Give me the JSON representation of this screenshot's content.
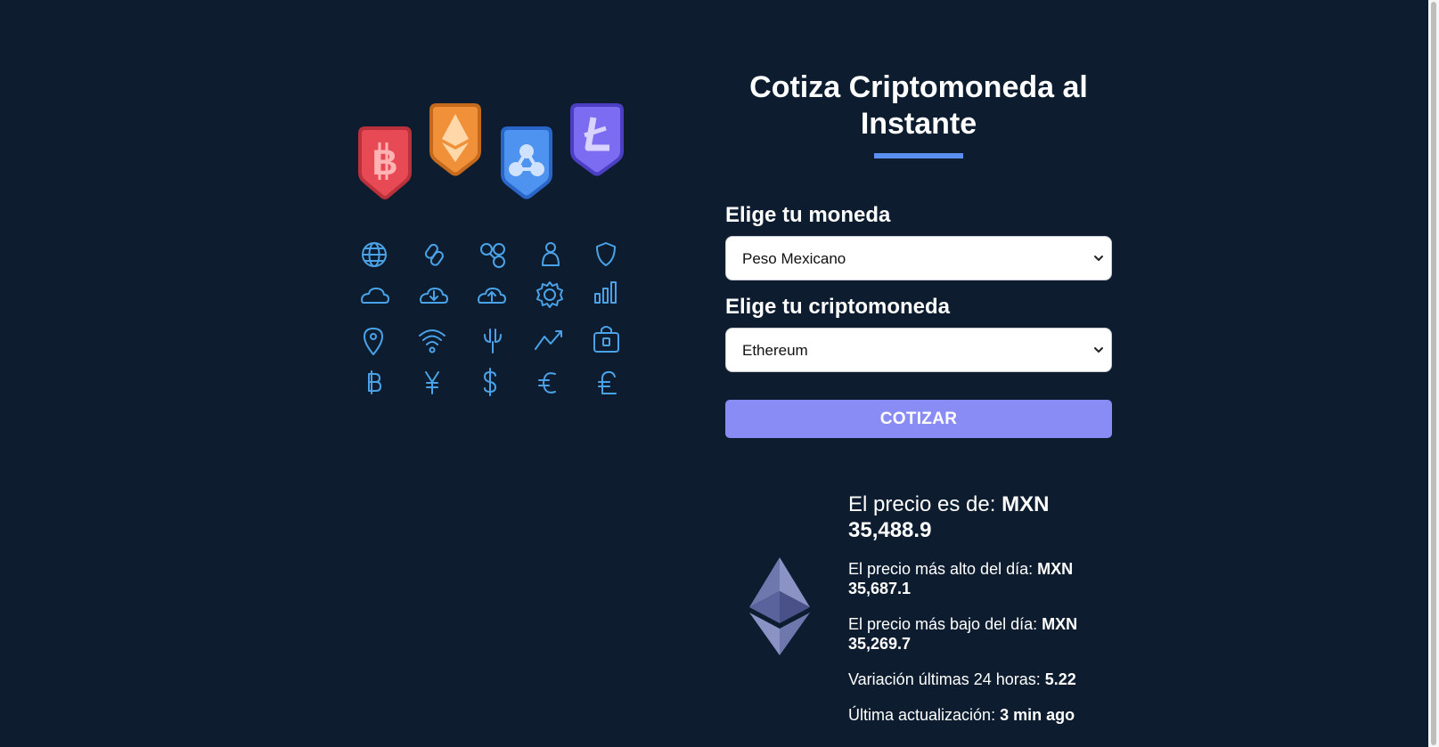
{
  "header": {
    "title": "Cotiza Criptomoneda al Instante"
  },
  "form": {
    "currency_label": "Elige tu moneda",
    "currency_selected": "Peso Mexicano",
    "crypto_label": "Elige tu criptomoneda",
    "crypto_selected": "Ethereum",
    "submit_label": "COTIZAR"
  },
  "result": {
    "price_label": "El precio es de: ",
    "price_value": "MXN 35,488.9",
    "high_label": "El precio más alto del día: ",
    "high_value": "MXN 35,687.1",
    "low_label": "El precio más bajo del día: ",
    "low_value": "MXN 35,269.7",
    "change_label": "Variación últimas 24 horas: ",
    "change_value": "5.22",
    "updated_label": "Última actualización: ",
    "updated_value": "3 min ago"
  },
  "illustration": {
    "badges": [
      "bitcoin-icon",
      "ethereum-icon",
      "ripple-icon",
      "litecoin-icon"
    ],
    "icons": [
      "globe-icon",
      "link-icon",
      "network-icon",
      "user-icon",
      "shield-icon",
      "cloud-icon",
      "cloud-download-icon",
      "cloud-upload-icon",
      "gear-icon",
      "bar-chart-icon",
      "location-pin-icon",
      "wifi-icon",
      "fork-icon",
      "trend-up-icon",
      "lock-bag-icon",
      "bitcoin-symbol-icon",
      "yen-icon",
      "dollar-icon",
      "euro-icon",
      "pound-icon"
    ]
  },
  "colors": {
    "background": "#0d1d2f",
    "accent": "#5a8ff0",
    "button": "#8a8cf6",
    "icon_stroke": "#4aa3e8"
  }
}
